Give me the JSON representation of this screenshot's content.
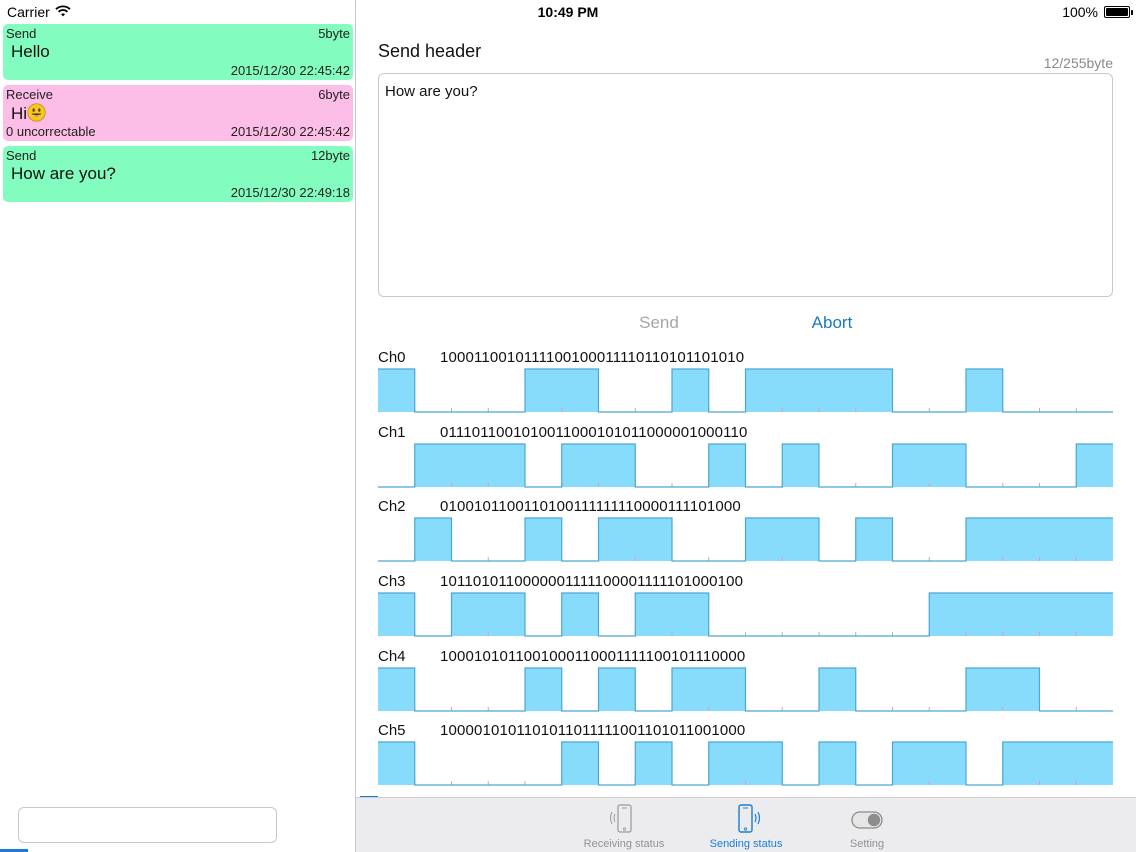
{
  "status_bar": {
    "carrier": "Carrier",
    "time": "10:49 PM",
    "battery": "100%"
  },
  "messages": [
    {
      "type": "Send",
      "size": "5byte",
      "text": "Hello",
      "extra": "",
      "time": "2015/12/30 22:45:42",
      "kind": "send"
    },
    {
      "type": "Receive",
      "size": "6byte",
      "text": "Hi",
      "emoji": "smiley-emoji",
      "extra": "0 uncorrectable",
      "time": "2015/12/30 22:45:42",
      "kind": "receive"
    },
    {
      "type": "Send",
      "size": "12byte",
      "text": "How are you?",
      "extra": "",
      "time": "2015/12/30 22:49:18",
      "kind": "send"
    }
  ],
  "compose": {
    "title": "Send header",
    "byte_count": "12/255byte",
    "value": "How are you?",
    "send_label": "Send",
    "abort_label": "Abort",
    "send_enabled": false
  },
  "channels": [
    {
      "label": "Ch0",
      "bits": "1000110010111100100011110110101101010"
    },
    {
      "label": "Ch1",
      "bits": "0111011001010011000101011000001000110"
    },
    {
      "label": "Ch2",
      "bits": "0100101100110100111111110000111101000"
    },
    {
      "label": "Ch3",
      "bits": "1011010110000001111100001111101000100"
    },
    {
      "label": "Ch4",
      "bits": "1000101011001000110001111100101110000"
    },
    {
      "label": "Ch5",
      "bits": "1000010101101011011111001101011001000"
    }
  ],
  "waveform_colors": {
    "fill": "#87dcfb",
    "stroke": "#4aa6d6",
    "baseline": "#4aa6d6",
    "tick": "#e59aa6"
  },
  "tabs": [
    {
      "label": "Receiving status",
      "icon": "phone-receive-icon",
      "active": false
    },
    {
      "label": "Sending status",
      "icon": "phone-send-icon",
      "active": true
    },
    {
      "label": "Setting",
      "icon": "toggle-icon",
      "active": false
    }
  ],
  "colors": {
    "send_bg": "#83fcbf",
    "receive_bg": "#fcbde6",
    "accent": "#1a7cd6"
  }
}
